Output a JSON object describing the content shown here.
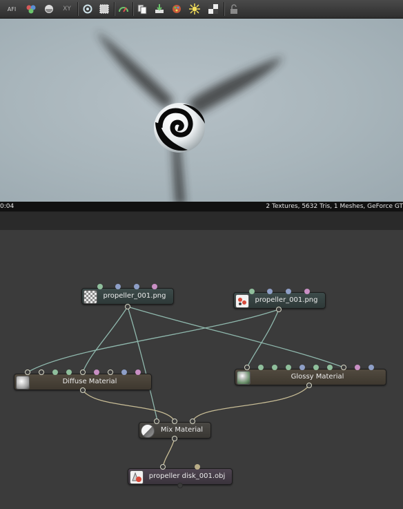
{
  "toolbar": {
    "buttons": [
      {
        "icon": "afi-icon",
        "glyph": "AFI"
      },
      {
        "icon": "color-balls-icon",
        "glyph": "●"
      },
      {
        "icon": "rotate-sphere-icon",
        "glyph": "◐"
      },
      {
        "icon": "xy-transform-icon",
        "glyph": "XY"
      },
      {
        "icon": "refresh-camera-icon",
        "glyph": "⟳"
      },
      {
        "icon": "region-select-icon",
        "glyph": "▦"
      },
      {
        "icon": "speedometer-icon",
        "glyph": "◔"
      },
      {
        "icon": "copy-icon",
        "glyph": "⎘"
      },
      {
        "icon": "import-icon",
        "glyph": "⇩"
      },
      {
        "icon": "palette-icon",
        "glyph": "✿"
      },
      {
        "icon": "light-burst-icon",
        "glyph": "✸"
      },
      {
        "icon": "checker-icon",
        "glyph": "▩"
      },
      {
        "icon": "lock-icon",
        "glyph": "🔓"
      }
    ]
  },
  "status": {
    "time": "0:04",
    "info": "2 Textures, 5632 Tris, 1 Meshes, GeForce GT"
  },
  "colors": {
    "tex_node": "#35423f",
    "mat_node": "#4a4337",
    "mesh_node": "#453c48",
    "wire_teal": "#8fb8ad",
    "wire_tan": "#c8bd96"
  },
  "nodes": {
    "tex1": {
      "label": "propeller_001.png",
      "icon": "checker-texture-icon"
    },
    "tex2": {
      "label": "propeller_001.png",
      "icon": "image-texture-icon"
    },
    "diffuse": {
      "label": "Diffuse Material",
      "icon": "diffuse-sphere-icon"
    },
    "glossy": {
      "label": "Glossy Material",
      "icon": "glossy-sphere-icon"
    },
    "mix": {
      "label": "Mix Material",
      "icon": "mix-sphere-icon"
    },
    "mesh": {
      "label": "propeller disk_001.obj",
      "icon": "mesh-cone-icon"
    }
  }
}
